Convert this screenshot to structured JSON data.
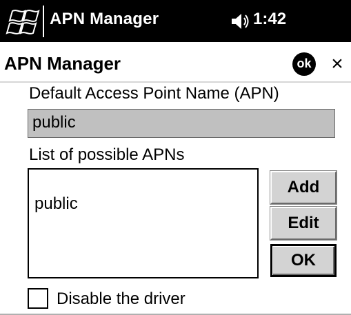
{
  "taskbar": {
    "title": "APN Manager",
    "time": "1:42",
    "start_icon": "windows-flag-icon",
    "volume_icon": "speaker-icon"
  },
  "header": {
    "title": "APN Manager",
    "ok_label": "ok",
    "close_label": "×"
  },
  "default_apn": {
    "label": "Default Access Point Name (APN)",
    "value": "public"
  },
  "apn_list": {
    "label": "List of possible APNs",
    "items": [
      "public"
    ]
  },
  "buttons": {
    "add": "Add",
    "edit": "Edit",
    "ok": "OK"
  },
  "disable_driver": {
    "label": "Disable the driver",
    "checked": false
  },
  "colors": {
    "taskbar_bg": "#000000",
    "field_bg": "#c0c0c0",
    "button_bg": "#d3d3d3"
  }
}
